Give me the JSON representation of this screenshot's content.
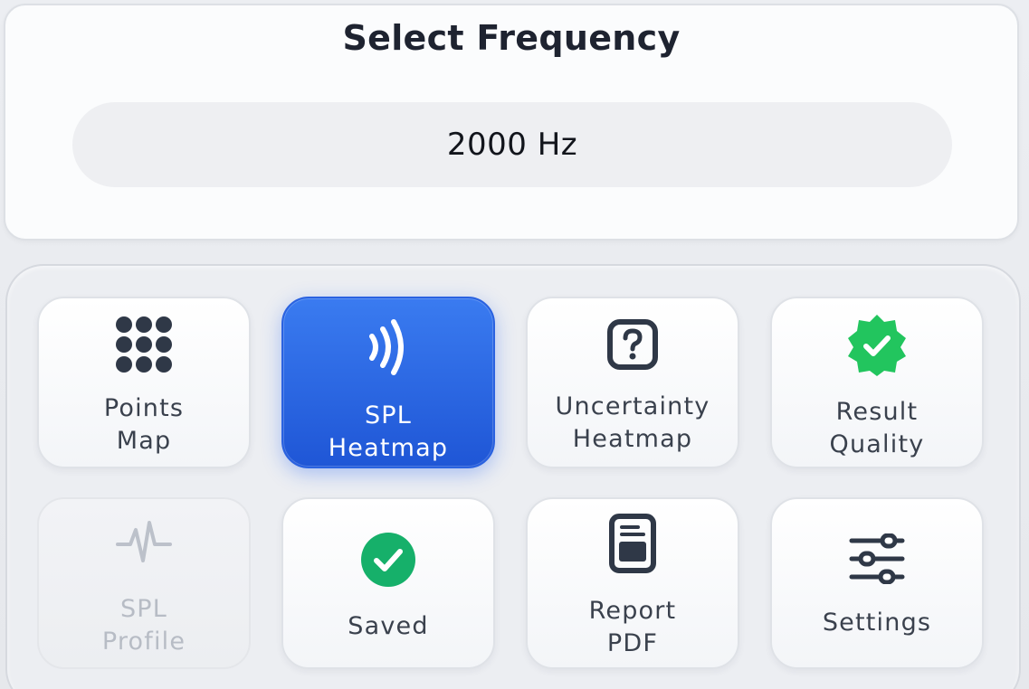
{
  "frequency": {
    "title": "Select Frequency",
    "value": "2000 Hz"
  },
  "actions": [
    {
      "id": "points-map",
      "label": "Points\nMap",
      "icon": "grid-dots-icon",
      "state": "normal"
    },
    {
      "id": "spl-heatmap",
      "label": "SPL\nHeatmap",
      "icon": "sound-waves-icon",
      "state": "active"
    },
    {
      "id": "uncertainty-heatmap",
      "label": "Uncertainty\nHeatmap",
      "icon": "question-box-icon",
      "state": "normal"
    },
    {
      "id": "result-quality",
      "label": "Result\nQuality",
      "icon": "verified-badge-icon",
      "state": "normal"
    },
    {
      "id": "spl-profile",
      "label": "SPL\nProfile",
      "icon": "waveform-pulse-icon",
      "state": "disabled"
    },
    {
      "id": "saved",
      "label": "Saved",
      "icon": "check-circle-icon",
      "state": "normal"
    },
    {
      "id": "report-pdf",
      "label": "Report\nPDF",
      "icon": "document-icon",
      "state": "normal"
    },
    {
      "id": "settings",
      "label": "Settings",
      "icon": "sliders-icon",
      "state": "normal"
    }
  ],
  "colors": {
    "accent": "#2563EB",
    "success": "#22C55E",
    "saved_green": "#16B06A",
    "icon_dark": "#2F3847",
    "disabled": "#B7BCC5"
  }
}
